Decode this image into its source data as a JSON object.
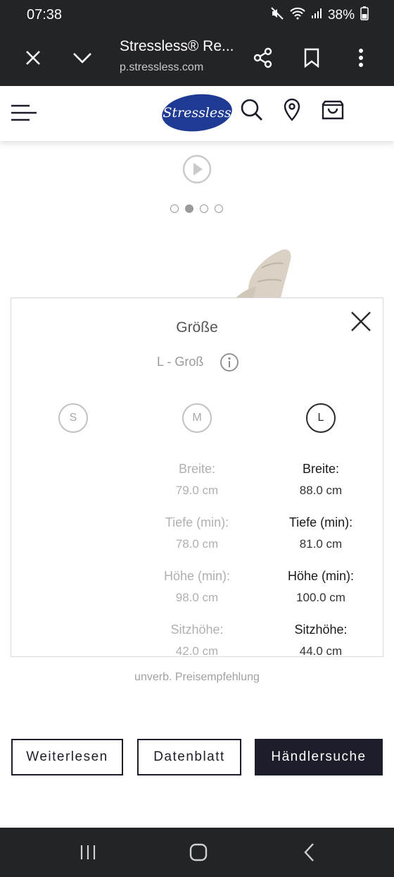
{
  "status_bar": {
    "time": "07:38",
    "battery": "38%"
  },
  "browser": {
    "title": "Stressless® Re...",
    "host": "p.stressless.com"
  },
  "site": {
    "logo_text": "Stressless"
  },
  "carousel": {
    "slide_count": 4,
    "active_index": 1
  },
  "size_panel": {
    "title": "Größe",
    "selected": "L - Groß",
    "sizes": [
      "S",
      "M",
      "L"
    ],
    "active_size": "L",
    "columns": {
      "M": [
        {
          "label": "Breite:",
          "value": "79.0 cm"
        },
        {
          "label": "Tiefe (min):",
          "value": "78.0 cm"
        },
        {
          "label": "Höhe (min):",
          "value": "98.0 cm"
        },
        {
          "label": "Sitzhöhe:",
          "value": "42.0 cm"
        }
      ],
      "L": [
        {
          "label": "Breite:",
          "value": "88.0 cm"
        },
        {
          "label": "Tiefe (min):",
          "value": "81.0 cm"
        },
        {
          "label": "Höhe (min):",
          "value": "100.0 cm"
        },
        {
          "label": "Sitzhöhe:",
          "value": "44.0 cm"
        }
      ]
    }
  },
  "price_note": "unverb. Preisempfehlung",
  "actions": {
    "read_more": "Weiterlesen",
    "datasheet": "Datenblatt",
    "dealer_search": "Händlersuche"
  },
  "colors": {
    "dark_bar": "#232427",
    "brand_navy": "#1b1e2a",
    "logo_blue": "#1f3a93"
  }
}
